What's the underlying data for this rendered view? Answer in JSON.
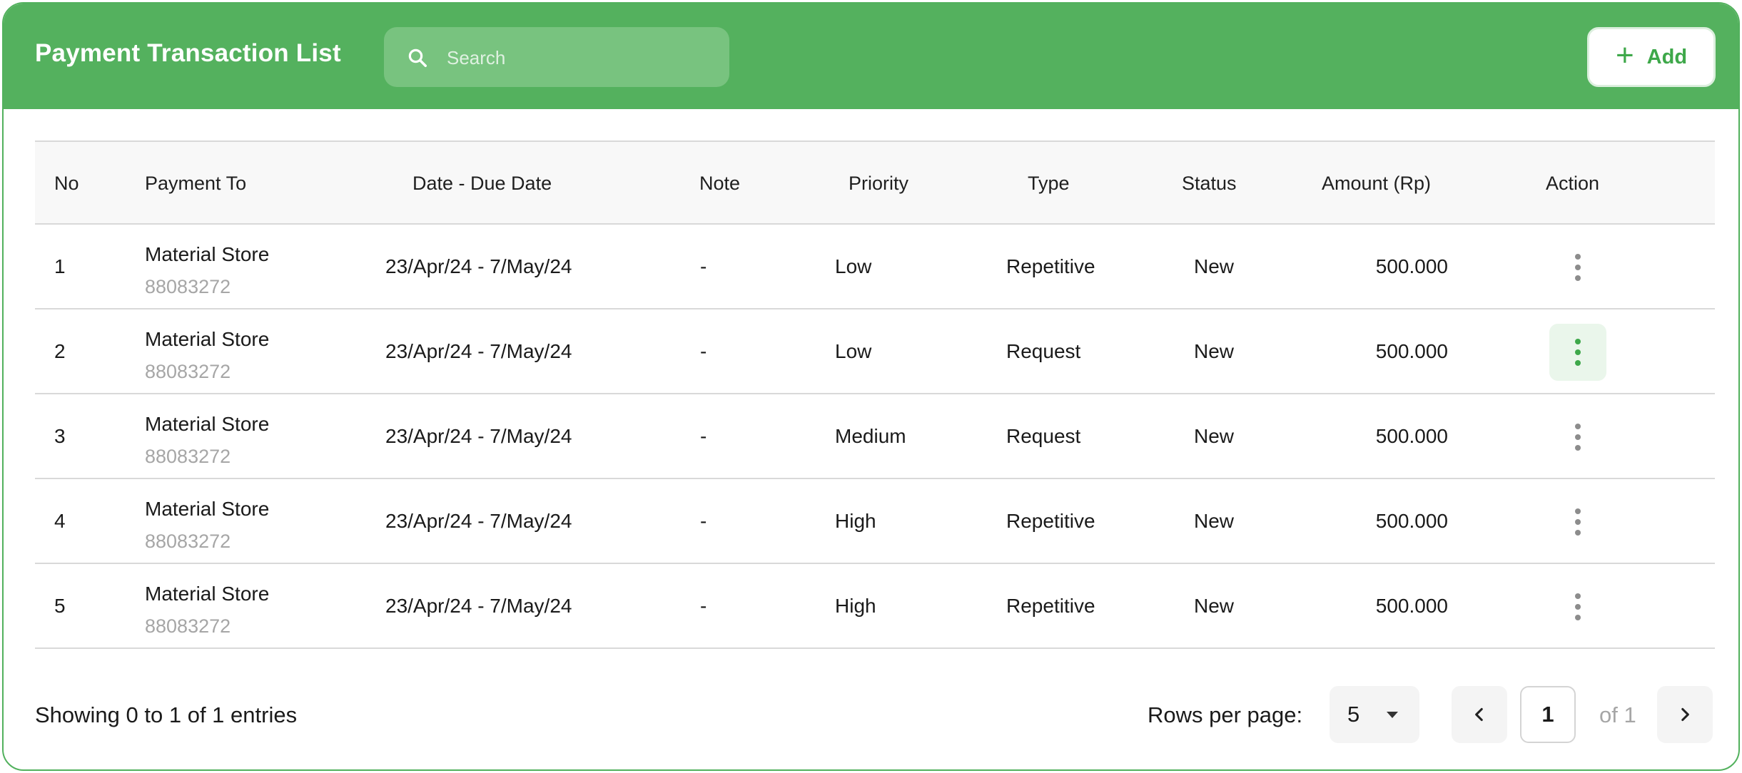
{
  "header": {
    "title": "Payment Transaction List",
    "search_placeholder": "Search",
    "add_label": "Add"
  },
  "columns": [
    "No",
    "Payment To",
    "Date - Due Date",
    "Note",
    "Priority",
    "Type",
    "Status",
    "Amount (Rp)",
    "Action"
  ],
  "rows": [
    {
      "no": "1",
      "payment_to": "Material Store",
      "account": "88083272",
      "date": "23/Apr/24 - 7/May/24",
      "note": "-",
      "priority": "Low",
      "type": "Repetitive",
      "status": "New",
      "amount": "500.000"
    },
    {
      "no": "2",
      "payment_to": "Material Store",
      "account": "88083272",
      "date": "23/Apr/24 - 7/May/24",
      "note": "-",
      "priority": "Low",
      "type": "Request",
      "status": "New",
      "amount": "500.000"
    },
    {
      "no": "3",
      "payment_to": "Material Store",
      "account": "88083272",
      "date": "23/Apr/24 - 7/May/24",
      "note": "-",
      "priority": "Medium",
      "type": "Request",
      "status": "New",
      "amount": "500.000"
    },
    {
      "no": "4",
      "payment_to": "Material Store",
      "account": "88083272",
      "date": "23/Apr/24 - 7/May/24",
      "note": "-",
      "priority": "High",
      "type": "Repetitive",
      "status": "New",
      "amount": "500.000"
    },
    {
      "no": "5",
      "payment_to": "Material Store",
      "account": "88083272",
      "date": "23/Apr/24 - 7/May/24",
      "note": "-",
      "priority": "High",
      "type": "Repetitive",
      "status": "New",
      "amount": "500.000"
    }
  ],
  "footer": {
    "entries_text": "Showing 0 to 1 of 1 entries",
    "rows_per_page_label": "Rows per page:",
    "rows_per_page_value": "5",
    "current_page": "1",
    "of_pages": "of 1"
  },
  "colors": {
    "brand_green": "#54b15e",
    "active_action_bg": "#eaf6eb"
  },
  "icons": {
    "search": "search-icon",
    "add": "plus-icon",
    "row_action": "kebab-menu-icon",
    "prev": "chevron-left-icon",
    "next": "chevron-right-icon",
    "select_caret": "caret-down-icon"
  }
}
